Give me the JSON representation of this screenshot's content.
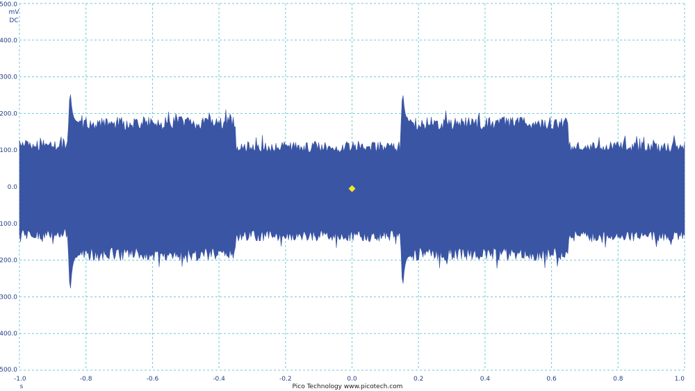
{
  "chart_data": {
    "type": "area",
    "title": "",
    "xlabel": "s",
    "ylabel": "mV",
    "ylabel_secondary": "DC",
    "xlim": [
      -1.0,
      1.0
    ],
    "ylim": [
      -500.0,
      500.0
    ],
    "x_ticks": [
      "-1.0",
      "-0.8",
      "-0.6",
      "-0.4",
      "-0.2",
      "0.0",
      "0.2",
      "0.4",
      "0.6",
      "0.8",
      "1.0"
    ],
    "y_ticks": [
      "500.0",
      "400.0",
      "300.0",
      "200.0",
      "100.0",
      "0.0",
      "-100.0",
      "-200.0",
      "-300.0",
      "-400.0",
      "-500.0"
    ],
    "grid": true,
    "series": [
      {
        "color": "#3a55a4",
        "segments": [
          {
            "x_start": -1.0,
            "x_end": -0.855,
            "upper": 115,
            "lower": -130,
            "noise": 15
          },
          {
            "x_start": -0.855,
            "x_end": -0.35,
            "upper": 175,
            "lower": -185,
            "noise": 18
          },
          {
            "x_start": -0.35,
            "x_end": 0.145,
            "upper": 110,
            "lower": -135,
            "noise": 15
          },
          {
            "x_start": 0.145,
            "x_end": 0.65,
            "upper": 175,
            "lower": -185,
            "noise": 18
          },
          {
            "x_start": 0.65,
            "x_end": 1.0,
            "upper": 110,
            "lower": -135,
            "noise": 15
          }
        ],
        "spikes": [
          {
            "x": -0.848,
            "upper": 275,
            "lower": -305
          },
          {
            "x": 0.152,
            "upper": 272,
            "lower": -288
          }
        ]
      }
    ],
    "trigger_marker": {
      "x": 0.0,
      "y": -5.0,
      "color": "#f5e626"
    },
    "credit": "Pico Technology  www.picotech.com"
  }
}
